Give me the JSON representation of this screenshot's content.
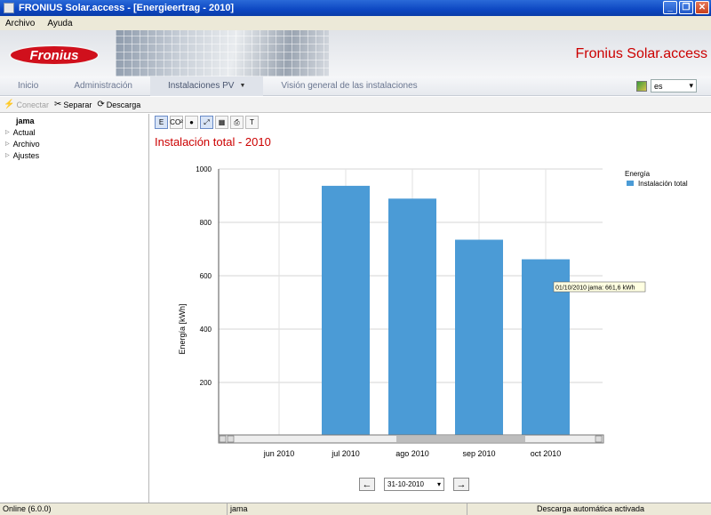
{
  "window": {
    "title": "FRONIUS Solar.access - [Energieertrag - 2010]"
  },
  "menu": [
    "Archivo",
    "Ayuda"
  ],
  "banner": {
    "logo_text": "Fronius",
    "brand": "Fronius Solar.access"
  },
  "nav": {
    "items": [
      "Inicio",
      "Administración",
      "Instalaciones PV",
      "Visión general de las instalaciones"
    ],
    "active_index": 2
  },
  "language": {
    "value": "es"
  },
  "toolbar": {
    "connect": "Conectar",
    "disconnect": "Separar",
    "download": "Descarga"
  },
  "sidebar": {
    "root": "jama",
    "items": [
      "Actual",
      "Archivo",
      "Ajustes"
    ]
  },
  "chart_toolbar": {
    "btn1": "E",
    "btn2": "CO²",
    "btn7": "T"
  },
  "date_nav": {
    "value": "31-10-2010"
  },
  "tooltip": "01/10/2010 jama: 661,6 kWh",
  "status": {
    "version": "Online (6.0.0)",
    "site": "jama",
    "download": "Descarga automática activada"
  },
  "chart_data": {
    "type": "bar",
    "title": "Instalación total - 2010",
    "ylabel": "Energía [kWh]",
    "xlabel": "",
    "categories": [
      "jun 2010",
      "jul 2010",
      "ago 2010",
      "sep 2010",
      "oct 2010"
    ],
    "series": [
      {
        "name": "Instalación total",
        "values": [
          2,
          937,
          889,
          735,
          661.6
        ],
        "color": "#4b9bd6"
      }
    ],
    "ylim": [
      0,
      1000
    ],
    "yticks": [
      200,
      400,
      600,
      800,
      1000
    ],
    "legend_title": "Energía",
    "legend_position": "top-right",
    "grid": true
  }
}
